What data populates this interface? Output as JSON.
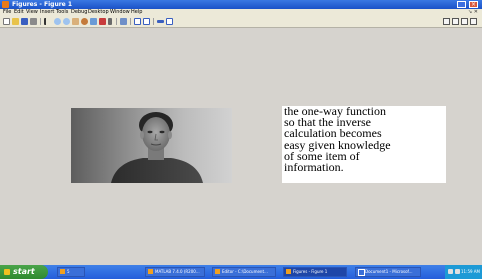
{
  "window": {
    "title": "Figures - Figure 1"
  },
  "menu": [
    "File",
    "Edit",
    "View",
    "Insert",
    "Tools",
    "Debug",
    "Desktop",
    "Window",
    "Help"
  ],
  "menu_right": "↘ ✕",
  "toolbar_icons": [
    "new-icon",
    "open-icon",
    "save-icon",
    "print-icon",
    "pointer-icon",
    "zoom-in-icon",
    "zoom-out-icon",
    "pan-icon",
    "rotate-icon",
    "datacursor-icon",
    "brush-icon",
    "link-icon",
    "colorbar-icon",
    "legend-icon",
    "hide-plottools-icon",
    "show-plottools-icon"
  ],
  "figure": {
    "text": "the one-way function\nso that the inverse\ncalculation becomes\neasy given knowledge\nof some item of\ninformation."
  },
  "taskbar": {
    "start_label": "start",
    "tasks": [
      {
        "label": "5"
      },
      {
        "label": "MATLAB 7.4.0 (R200..."
      },
      {
        "label": "Editor - C:\\Document..."
      },
      {
        "label": "Figures - Figure 1"
      },
      {
        "label": "Document1 - Microsof..."
      }
    ],
    "clock": "11:59 AM"
  }
}
